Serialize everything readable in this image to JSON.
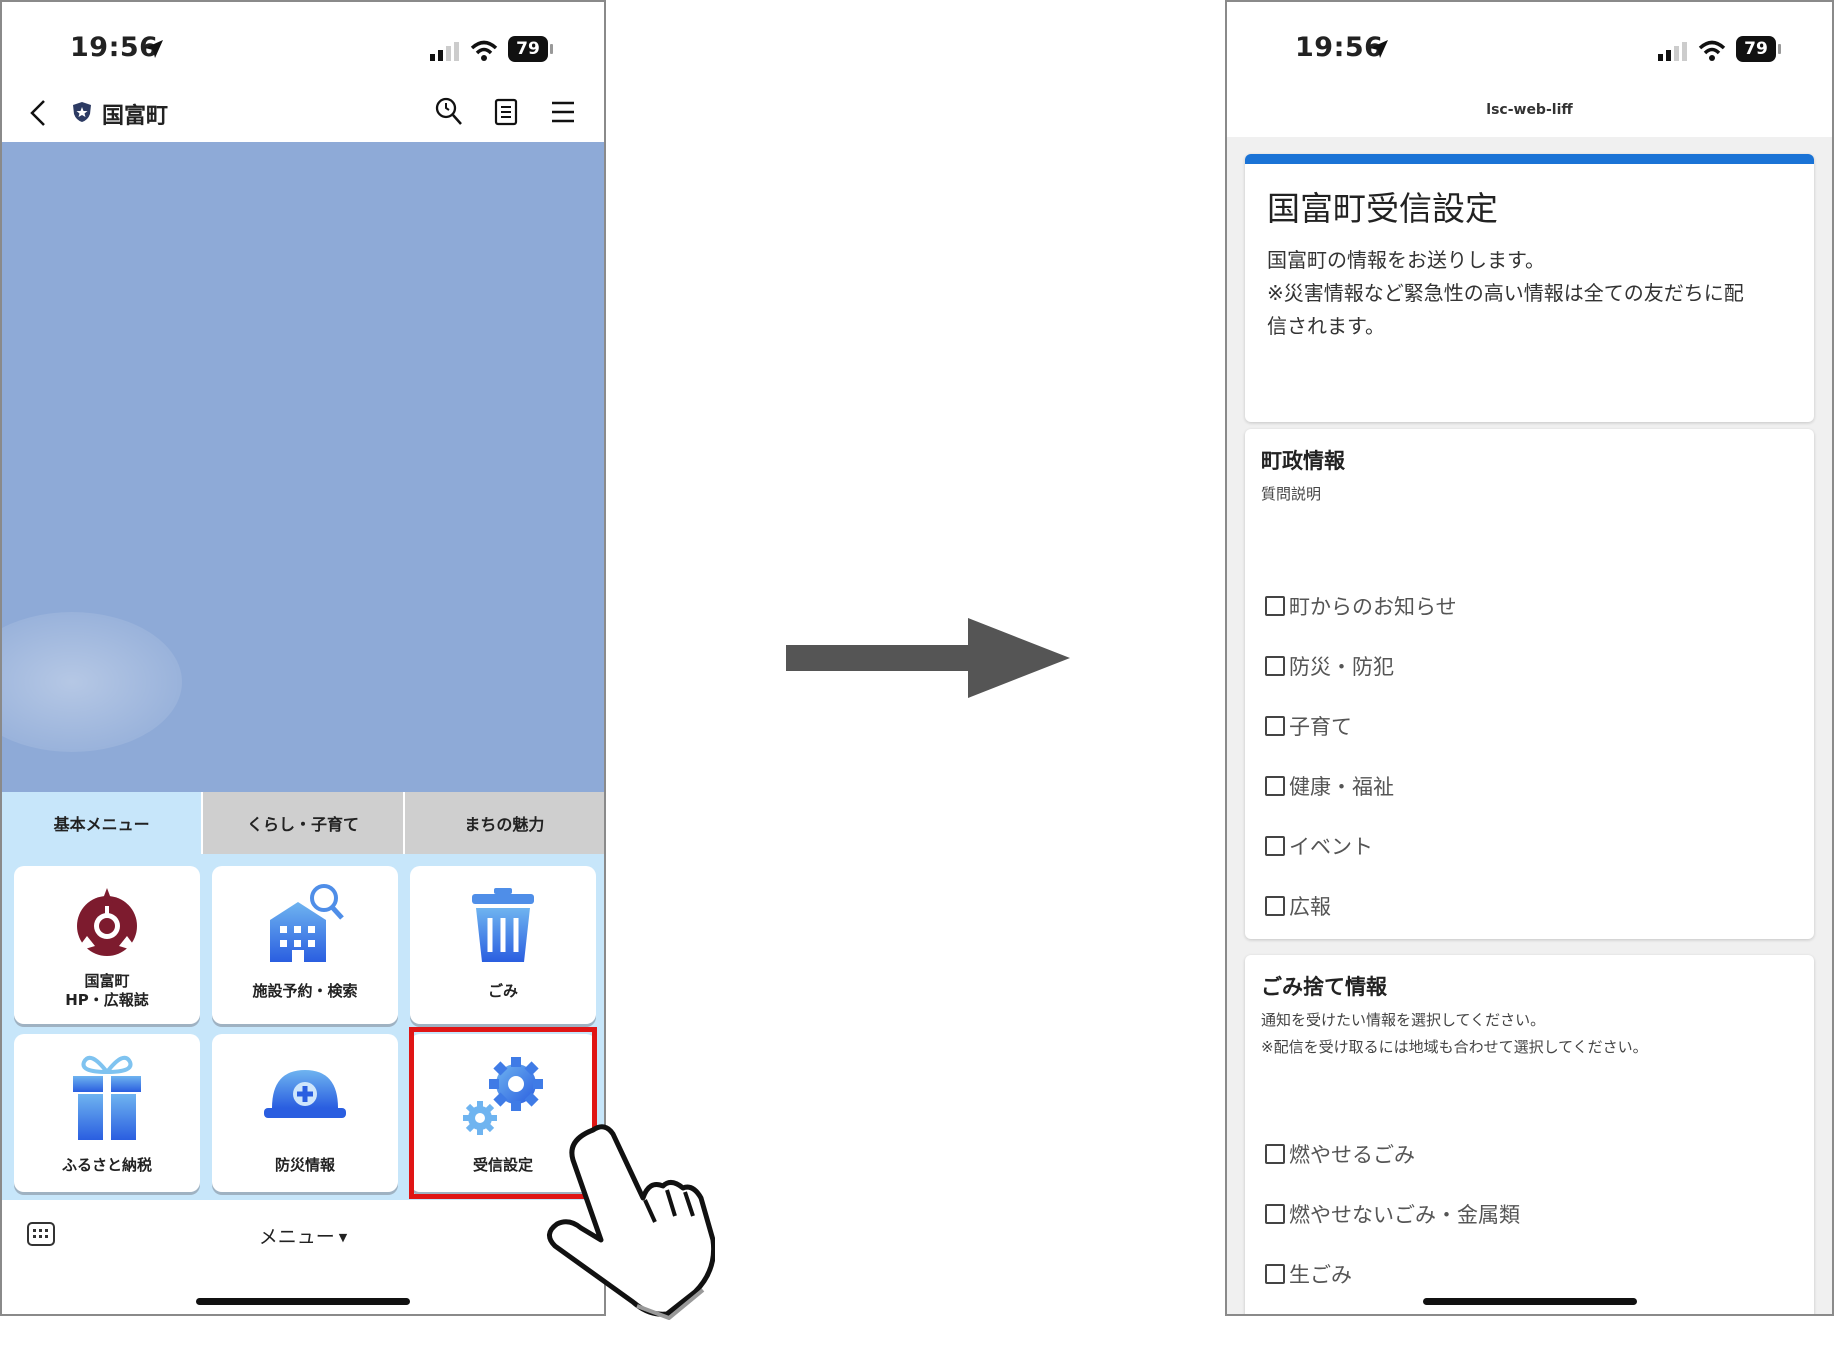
{
  "left_phone": {
    "status": {
      "time": "19:56",
      "battery": "79"
    },
    "header": {
      "account_name": "国富町"
    },
    "tabs": [
      {
        "label": "基本メニュー",
        "active": true
      },
      {
        "label": "くらし・子育て",
        "active": false
      },
      {
        "label": "まちの魅力",
        "active": false
      }
    ],
    "tiles": [
      {
        "label_line1": "国富町",
        "label_line2": "HP・広報誌",
        "icon": "town-emblem-icon"
      },
      {
        "label": "施設予約・検索",
        "icon": "building-search-icon"
      },
      {
        "label": "ごみ",
        "icon": "trash-icon"
      },
      {
        "label": "ふるさと納税",
        "icon": "gift-icon"
      },
      {
        "label": "防災情報",
        "icon": "helmet-icon"
      },
      {
        "label": "受信設定",
        "icon": "gears-icon",
        "highlighted": true
      }
    ],
    "bottom": {
      "menu_label": "メニュー",
      "caret": "▼"
    }
  },
  "right_phone": {
    "status": {
      "time": "19:56",
      "battery": "79"
    },
    "header_title": "lsc-web-liff",
    "form": {
      "title": "国富町受信設定",
      "desc_line1": "国富町の情報をお送りします。",
      "desc_line2": "※災害情報など緊急性の高い情報は全ての友だちに配",
      "desc_line3": "信されます。",
      "accent": "#1a73d6"
    },
    "q1": {
      "title": "町政情報",
      "desc": "質問説明",
      "options": [
        "町からのお知らせ",
        "防災・防犯",
        "子育て",
        "健康・福祉",
        "イベント",
        "広報"
      ]
    },
    "q2": {
      "title": "ごみ捨て情報",
      "desc_line1": "通知を受けたい情報を選択してください。",
      "desc_line2": "※配信を受け取るには地域も合わせて選択してください。",
      "options": [
        "燃やせるごみ",
        "燃やせないごみ・金属類",
        "生ごみ"
      ]
    }
  },
  "colors": {
    "highlight": "#e01515",
    "sky": "#8eaad7",
    "menu_bg": "#c7e6fa"
  }
}
